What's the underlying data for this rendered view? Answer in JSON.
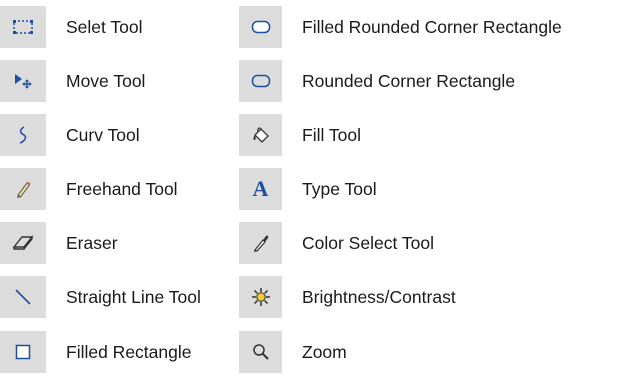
{
  "tools_left": [
    {
      "icon": "select-marquee-icon",
      "label": "Selet Tool"
    },
    {
      "icon": "move-arrow-icon",
      "label": "Move Tool"
    },
    {
      "icon": "curve-icon",
      "label": "Curv Tool"
    },
    {
      "icon": "pencil-icon",
      "label": "Freehand Tool"
    },
    {
      "icon": "eraser-icon",
      "label": "Eraser"
    },
    {
      "icon": "diagonal-line-icon",
      "label": "Straight Line Tool"
    },
    {
      "icon": "square-outline-icon",
      "label": "Filled Rectangle"
    }
  ],
  "tools_right": [
    {
      "icon": "filled-rounded-rectangle-icon",
      "label": "Filled Rounded Corner Rectangle"
    },
    {
      "icon": "rounded-rectangle-icon",
      "label": "Rounded Corner Rectangle"
    },
    {
      "icon": "paint-bucket-icon",
      "label": "Fill Tool"
    },
    {
      "icon": "type-letter-a-icon",
      "label": "Type Tool",
      "glyph": "A"
    },
    {
      "icon": "eyedropper-icon",
      "label": "Color Select Tool"
    },
    {
      "icon": "brightness-sun-icon",
      "label": "Brightness/Contrast"
    },
    {
      "icon": "magnifier-icon",
      "label": "Zoom"
    }
  ],
  "colors": {
    "button_bg": "#dcdcdc",
    "icon_blue": "#1f4ea0",
    "icon_dark": "#333333",
    "text": "#1a1a1a"
  }
}
